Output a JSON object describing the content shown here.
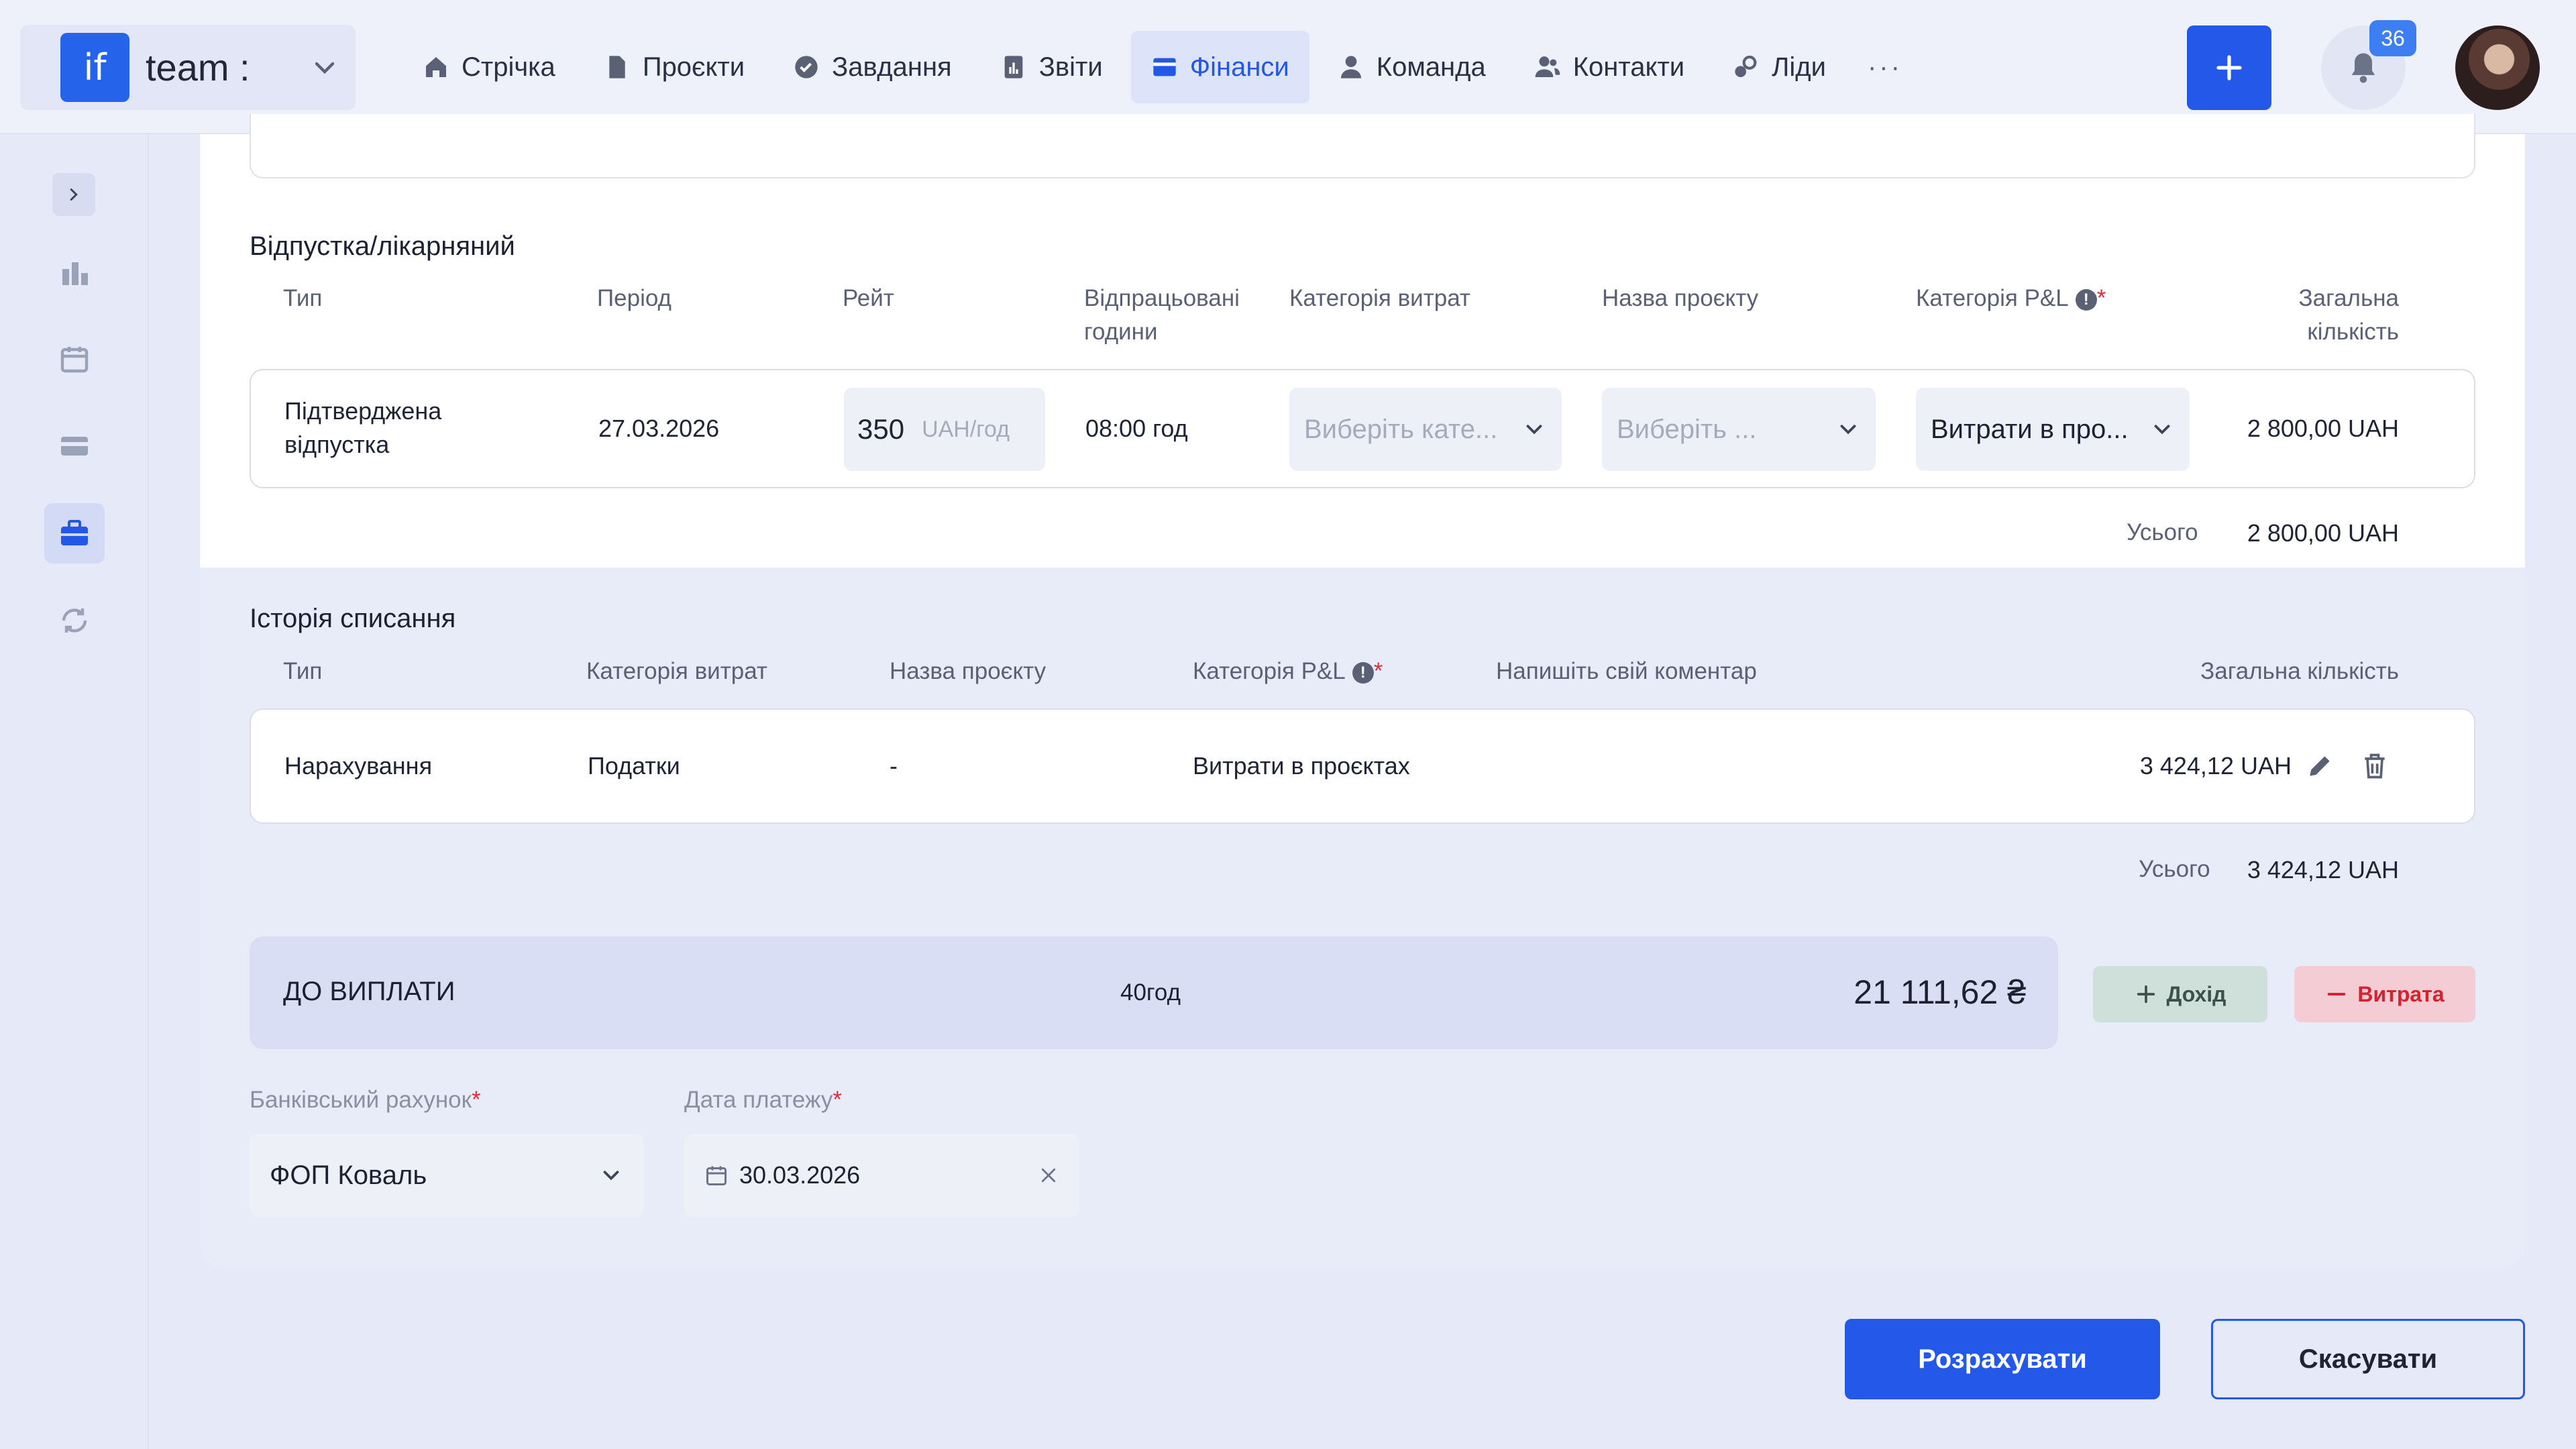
{
  "colors": {
    "accent": "#2458e8",
    "page_bg": "#e6e9f7",
    "danger": "#e02d39"
  },
  "brand": {
    "logo": "if",
    "name": "team :"
  },
  "nav": [
    {
      "label": "Стрічка",
      "icon": "home-icon"
    },
    {
      "label": "Проєкти",
      "icon": "document-icon"
    },
    {
      "label": "Завдання",
      "icon": "check-circle-icon"
    },
    {
      "label": "Звіти",
      "icon": "report-icon"
    },
    {
      "label": "Фінанси",
      "icon": "wallet-icon",
      "active": true
    },
    {
      "label": "Команда",
      "icon": "person-icon"
    },
    {
      "label": "Контакти",
      "icon": "contacts-icon"
    },
    {
      "label": "Ліди",
      "icon": "leads-icon"
    }
  ],
  "nav_more": "···",
  "notifications": {
    "count": "36"
  },
  "vacation": {
    "title": "Відпустка/лікарняний",
    "headers": {
      "type": "Тип",
      "period": "Період",
      "rate": "Рейт",
      "hours_1": "Відпрацьовані",
      "hours_2": "години",
      "expense_category": "Категорія витрат",
      "project_name": "Назва проєкту",
      "pnl_category": "Категорія P&L",
      "total_1": "Загальна",
      "total_2": "кількість"
    },
    "row": {
      "type_1": "Підтверджена",
      "type_2": "відпустка",
      "period": "27.03.2026",
      "rate_value": "350",
      "rate_unit": "UAH/год",
      "hours": "08:00 год",
      "expense_category_placeholder": "Виберіть кате...",
      "project_placeholder": "Виберіть ...",
      "pnl_category": "Витрати в про...",
      "total": "2 800,00 UAH"
    },
    "sum_label": "Усього",
    "sum_value": "2 800,00 UAH"
  },
  "history": {
    "title": "Історія списання",
    "headers": {
      "type": "Тип",
      "expense_category": "Категорія витрат",
      "project_name": "Назва проєкту",
      "pnl_category": "Категорія P&L",
      "comment": "Напишіть свій коментар",
      "total": "Загальна кількість"
    },
    "row": {
      "type": "Нарахування",
      "expense_category": "Податки",
      "project_name": "-",
      "pnl_category": "Витрати в проєктах",
      "total": "3 424,12 UAH"
    },
    "sum_label": "Усього",
    "sum_value": "3 424,12 UAH"
  },
  "payout": {
    "label": "ДО ВИПЛАТИ",
    "hours": "40год",
    "amount": "21 111,62 ₴",
    "income_label": "Дохід",
    "expense_label": "Витрата"
  },
  "bank": {
    "label": "Банківський рахунок",
    "value": "ФОП Коваль"
  },
  "payment_date": {
    "label": "Дата платежу",
    "value": "30.03.2026"
  },
  "actions": {
    "calculate": "Розрахувати",
    "cancel": "Скасувати"
  }
}
